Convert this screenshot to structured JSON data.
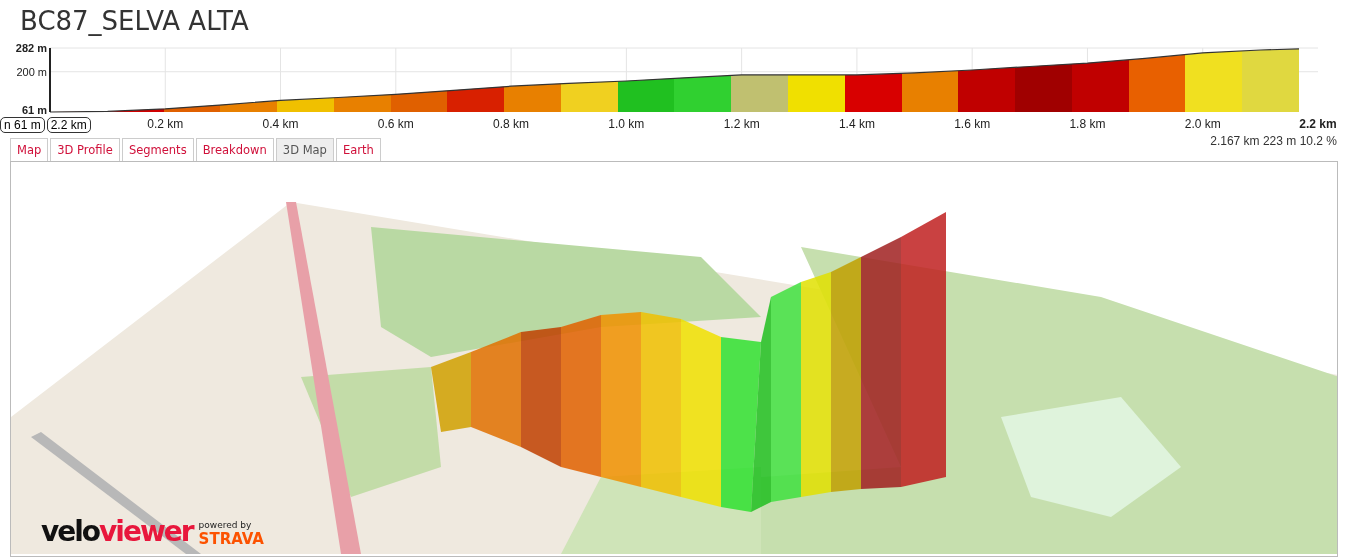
{
  "title": "BC87_SELVA ALTA",
  "profile": {
    "cursor_labels": [
      "n 61 m",
      "2.2 km"
    ],
    "chart_data": {
      "type": "area",
      "x": [
        0,
        0.1,
        0.2,
        0.3,
        0.4,
        0.5,
        0.6,
        0.7,
        0.8,
        0.9,
        1.0,
        1.1,
        1.2,
        1.3,
        1.4,
        1.5,
        1.6,
        1.7,
        1.8,
        1.9,
        2.0,
        2.1,
        2.167
      ],
      "xlim": [
        0,
        2.2
      ],
      "grid": true,
      "series": [
        {
          "values": [
            61,
            63,
            72,
            86,
            101,
            111,
            122,
            136,
            150,
            160,
            168,
            179,
            189,
            189,
            189,
            196,
            206,
            218,
            230,
            246,
            265,
            275,
            279
          ]
        }
      ],
      "ylim": [
        61,
        282
      ],
      "yticks": [
        {
          "value": 61,
          "label": "61 m"
        },
        {
          "value": 200,
          "label": "200 m"
        },
        {
          "value": 282,
          "label": "282 m"
        }
      ],
      "xticks": [
        {
          "value": 0.2,
          "label": "0.2 km"
        },
        {
          "value": 0.4,
          "label": "0.4 km"
        },
        {
          "value": 0.6,
          "label": "0.6 km"
        },
        {
          "value": 0.8,
          "label": "0.8 km"
        },
        {
          "value": 1.0,
          "label": "1.0 km"
        },
        {
          "value": 1.2,
          "label": "1.2 km"
        },
        {
          "value": 1.4,
          "label": "1.4 km"
        },
        {
          "value": 1.6,
          "label": "1.6 km"
        },
        {
          "value": 1.8,
          "label": "1.8 km"
        },
        {
          "value": 2.0,
          "label": "2.0 km"
        },
        {
          "value": 2.2,
          "label": "2.2 km"
        }
      ]
    }
  },
  "tabs": [
    {
      "label": "Map",
      "selected": false
    },
    {
      "label": "3D Profile",
      "selected": false
    },
    {
      "label": "Segments",
      "selected": false
    },
    {
      "label": "Breakdown",
      "selected": false
    },
    {
      "label": "3D Map",
      "selected": true
    },
    {
      "label": "Earth",
      "selected": false
    }
  ],
  "stats": "2.167 km 223 m 10.2 %",
  "map": {
    "logo": [
      "velo",
      "viewer"
    ],
    "powered_by": "powered by",
    "brand": "STRAVA"
  }
}
